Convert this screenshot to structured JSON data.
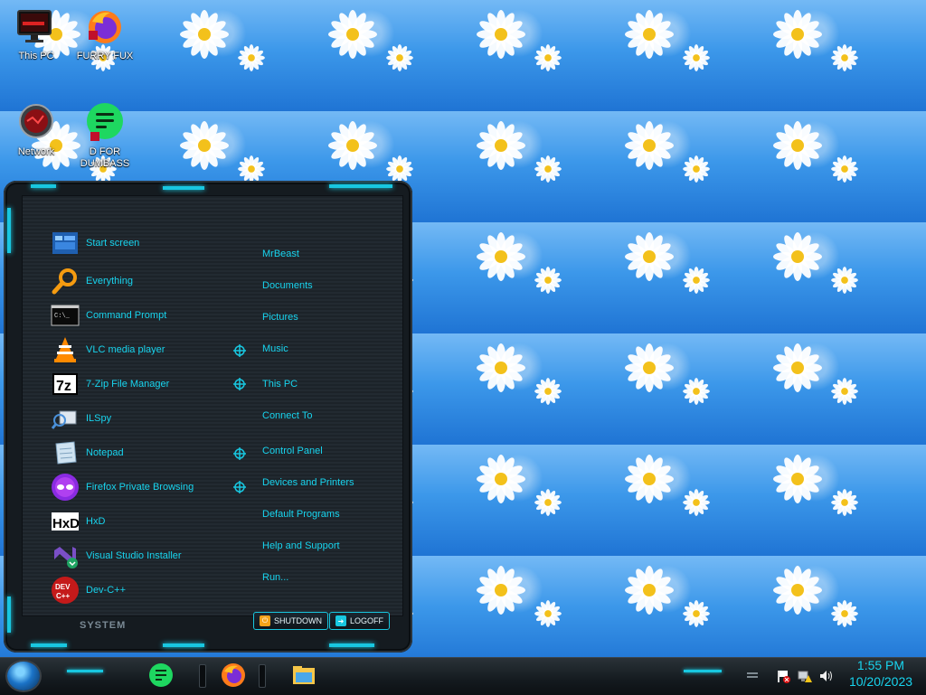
{
  "desktop": {
    "icons": [
      {
        "label": "This PC"
      },
      {
        "label": "FURRY FUX"
      },
      {
        "label": "Network"
      },
      {
        "label": "D FOR DUMBASS"
      }
    ]
  },
  "start_menu": {
    "apps": [
      {
        "label": "Start screen",
        "icon": "start-screen-icon"
      },
      {
        "label": "Everything",
        "icon": "search-icon"
      },
      {
        "label": "Command Prompt",
        "icon": "terminal-icon"
      },
      {
        "label": "VLC media player",
        "icon": "vlc-cone-icon"
      },
      {
        "label": "7-Zip File Manager",
        "icon": "7zip-icon"
      },
      {
        "label": "ILSpy",
        "icon": "ilspy-icon"
      },
      {
        "label": "Notepad",
        "icon": "notepad-icon"
      },
      {
        "label": "Firefox Private Browsing",
        "icon": "private-browsing-icon"
      },
      {
        "label": "HxD",
        "icon": "hxd-icon"
      },
      {
        "label": "Visual Studio Installer",
        "icon": "visual-studio-installer-icon"
      },
      {
        "label": "Dev-C++",
        "icon": "devcpp-icon"
      }
    ],
    "places": [
      {
        "label": "MrBeast"
      },
      {
        "label": "Documents"
      },
      {
        "label": "Pictures"
      },
      {
        "label": "Music"
      },
      {
        "label": "This PC"
      },
      {
        "label": "Connect To"
      },
      {
        "label": "Control Panel"
      },
      {
        "label": "Devices and Printers"
      },
      {
        "label": "Default Programs"
      },
      {
        "label": "Help and Support"
      },
      {
        "label": "Run..."
      }
    ],
    "footer": {
      "system_label": "SYSTEM",
      "shutdown_label": "SHUTDOWN",
      "logoff_label": "LOGOFF"
    }
  },
  "taskbar": {
    "clock_time": "1:55 PM",
    "clock_date": "10/20/2023"
  },
  "colors": {
    "accent": "#18c7e0",
    "menu_bg": "#1c2329",
    "taskbar_bg": "#141a1f"
  }
}
